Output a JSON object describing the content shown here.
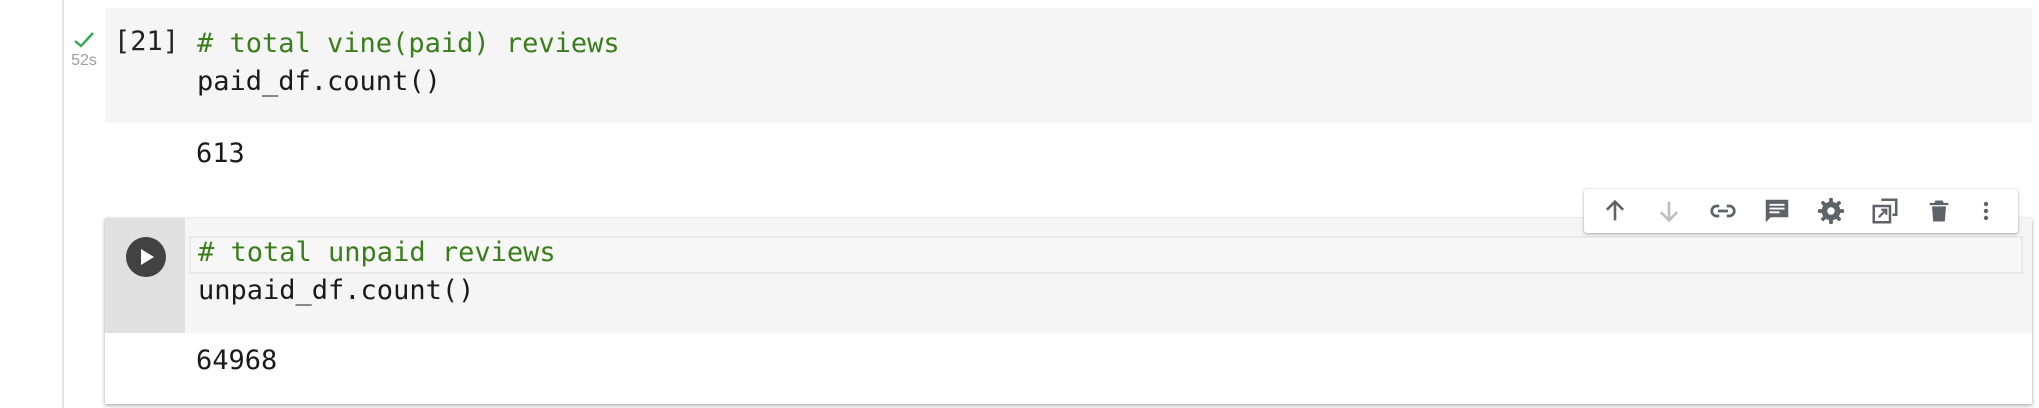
{
  "cells": [
    {
      "execution_count": "[21]",
      "status": "success",
      "exec_time": "52s",
      "code_lines": [
        {
          "type": "comment",
          "text": "# total vine(paid) reviews"
        },
        {
          "type": "code",
          "text": "paid_df.count()"
        }
      ],
      "output": "613"
    },
    {
      "run_button_icon": "play-icon",
      "code_lines": [
        {
          "type": "comment",
          "text": "# total unpaid reviews"
        },
        {
          "type": "code",
          "text": "unpaid_df.count()"
        }
      ],
      "output": "64968"
    }
  ],
  "toolbar": {
    "buttons": [
      {
        "icon": "arrow-up-icon",
        "enabled": true
      },
      {
        "icon": "arrow-down-icon",
        "enabled": false
      },
      {
        "icon": "link-icon",
        "enabled": true
      },
      {
        "icon": "comment-icon",
        "enabled": true
      },
      {
        "icon": "gear-icon",
        "enabled": true
      },
      {
        "icon": "mirror-cell-icon",
        "enabled": true
      },
      {
        "icon": "trash-icon",
        "enabled": true
      },
      {
        "icon": "more-vert-icon",
        "enabled": true
      }
    ]
  },
  "colors": {
    "comment": "#3a7d1b",
    "code": "#1a1a1a",
    "success_check": "#34a853",
    "code_bg": "#f5f5f5",
    "gutter_bg": "#e0e0e0",
    "icon": "#5f6368",
    "icon_disabled": "#bdbdbd"
  }
}
